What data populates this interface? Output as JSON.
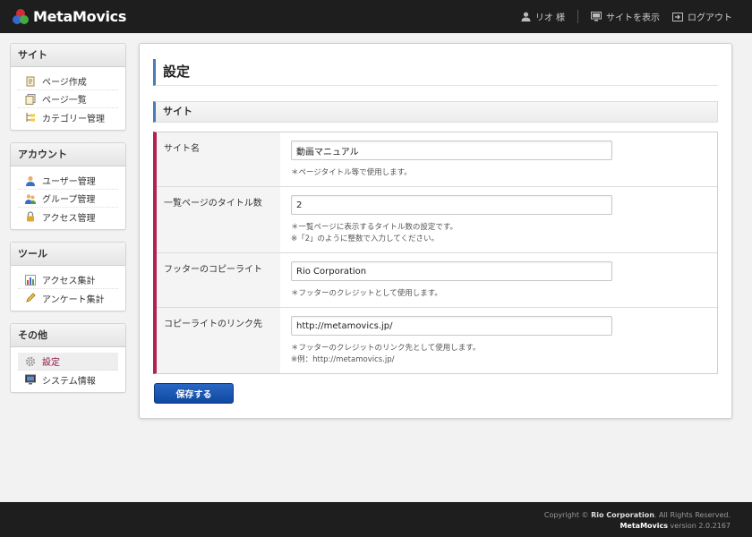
{
  "header": {
    "logo_text": "MetaMovics",
    "user_label": "リオ 様",
    "view_site_label": "サイトを表示",
    "logout_label": "ログアウト"
  },
  "sidebar": {
    "groups": [
      {
        "title": "サイト",
        "items": [
          {
            "label": "ページ作成",
            "icon": "page-create-icon"
          },
          {
            "label": "ページ一覧",
            "icon": "page-list-icon"
          },
          {
            "label": "カテゴリー管理",
            "icon": "category-icon"
          }
        ]
      },
      {
        "title": "アカウント",
        "items": [
          {
            "label": "ユーザー管理",
            "icon": "user-icon"
          },
          {
            "label": "グループ管理",
            "icon": "group-icon"
          },
          {
            "label": "アクセス管理",
            "icon": "lock-icon"
          }
        ]
      },
      {
        "title": "ツール",
        "items": [
          {
            "label": "アクセス集計",
            "icon": "chart-icon"
          },
          {
            "label": "アンケート集計",
            "icon": "pencil-icon"
          }
        ]
      },
      {
        "title": "その他",
        "items": [
          {
            "label": "設定",
            "icon": "gear-icon",
            "active": true
          },
          {
            "label": "システム情報",
            "icon": "monitor-icon"
          }
        ]
      }
    ]
  },
  "main": {
    "title": "設定",
    "section_title": "サイト",
    "fields": [
      {
        "label": "サイト名",
        "value": "動画マニュアル",
        "notes": [
          "＊ページタイトル等で使用します。"
        ]
      },
      {
        "label": "一覧ページのタイトル数",
        "value": "2",
        "notes": [
          "＊一覧ページに表示するタイトル数の設定です。",
          "※「2」のように整数で入力してください。"
        ]
      },
      {
        "label": "フッターのコピーライト",
        "value": "Rio Corporation",
        "notes": [
          "＊フッターのクレジットとして使用します。"
        ]
      },
      {
        "label": "コピーライトのリンク先",
        "value": "http://metamovics.jp/",
        "notes": [
          "＊フッターのクレジットのリンク先として使用します。",
          "※例：http://metamovics.jp/"
        ]
      }
    ],
    "save_label": "保存する"
  },
  "footer": {
    "copyright_prefix": "Copyright ©",
    "company": "Rio Corporation",
    "rights": ". All Rights Reserved.",
    "brand": "MetaMovics",
    "version": "version 2.0.2167"
  },
  "colors": {
    "header_bg": "#1e1e1e",
    "accent_blue": "#4b7bb5",
    "accent_red": "#b2224f",
    "button_blue": "#1a56b0"
  }
}
